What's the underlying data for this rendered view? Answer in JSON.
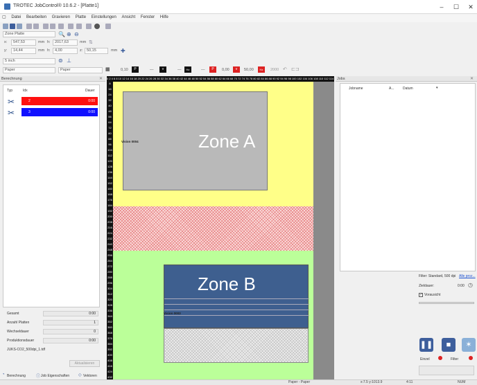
{
  "window": {
    "title": "TROTEC JobControl® 10.6.2 - [Platte1]"
  },
  "menu": [
    "Datei",
    "Bearbeiten",
    "Gravieren",
    "Platte",
    "Einstellungen",
    "Ansicht",
    "Fenster",
    "Hilfe"
  ],
  "toolbar": {
    "plate_select": "Zone Platte",
    "x_label": "x:",
    "x_value": "547,53",
    "x_unit": "mm",
    "y_label": "y:",
    "y_value": "14,44",
    "y_unit": "mm",
    "h_label": "h:",
    "h_value": "2017,63",
    "h_unit": "mm",
    "w_label": "h:",
    "w_value": "4,00",
    "z_label": "z:",
    "z_value": "50,15",
    "z_unit": "mm",
    "lens": "5 inch",
    "material1": "Paper",
    "material2": "Paper",
    "power_value": "0,10",
    "ppi_value": "0,00",
    "speed_value": "50,00",
    "freq_value": "2000"
  },
  "left_panel": {
    "header": "Berechnung",
    "col_typ": "Typ",
    "col_idx": "Idx",
    "col_dauer": "Dauer",
    "rows": [
      {
        "idx": "2",
        "dauer": "0:00",
        "color": "#ff1010"
      },
      {
        "idx": "3",
        "dauer": "0:00",
        "color": "#1010ff"
      }
    ],
    "stats": [
      {
        "label": "Gesamt",
        "value": "0:00"
      },
      {
        "label": "Anzahl Platten",
        "value": "1"
      },
      {
        "label": "Wechseldauer",
        "value": "0"
      },
      {
        "label": "Produktionsdauer",
        "value": "0:00"
      }
    ],
    "material_file": "JUKS-CO2_500dpi_1.tdf",
    "update_button": "Aktualisieren",
    "tabs": [
      "Berechnung",
      "Job Eigenschaften",
      "Vektoren"
    ]
  },
  "canvas": {
    "ruler_top": "0 2 4 6 8 10 12 14 16 18 20 22 24 26 28 30 32 34 36 38 40 42 44 46 48 50 52 54 56 58 60 62 64 66 68 70 72 74 76 78 80 82 84 86 88 90 92 94 96 98 100 102 104 106 108 110 112 114 116 118 120 122 124 126 128 130 132 134 136 138 140 142 144 146 148 150 152 154 156 158 160 162 164 166 168 170 172 174 176 178 180 182 184 186 188 190 192 194 196 198 200 202 204 206 208 210 212 214 216 218 220 222 224",
    "ruler_left": [
      "8",
      "16",
      "24",
      "32",
      "40",
      "48",
      "56",
      "64",
      "72",
      "80",
      "88",
      "96",
      "104",
      "112",
      "120",
      "128",
      "136",
      "144",
      "152",
      "160",
      "168",
      "176",
      "184",
      "192",
      "200",
      "208",
      "216",
      "224",
      "232",
      "240",
      "248",
      "256",
      "264",
      "272",
      "280",
      "288",
      "296",
      "304",
      "312",
      "320",
      "328",
      "336",
      "344",
      "352",
      "360",
      "368",
      "376",
      "384",
      "392",
      "400",
      "408",
      "416",
      "424",
      "432"
    ],
    "zone_a": "Zone A",
    "zone_b": "Zone B",
    "job_a": "Vision 0004",
    "job_b": "Vision 0003"
  },
  "right_panel": {
    "header": "Jobs",
    "col_jobname": "Jobname",
    "col_a": "A...",
    "col_datum": "Datum",
    "filter_text": "Filter: Standard, 500 dpi",
    "filter_link": "Alle proz...",
    "duration_label": "Zieldauer:",
    "duration_value": "0:00",
    "preview_label": "Vorausicht",
    "laser_label": "Einzel",
    "filter_label": "Filter"
  },
  "statusbar": {
    "left_text": "Paper - Paper",
    "coords": "x:7.5  y:1013.9",
    "time": "4:11",
    "mode": "NUM"
  }
}
